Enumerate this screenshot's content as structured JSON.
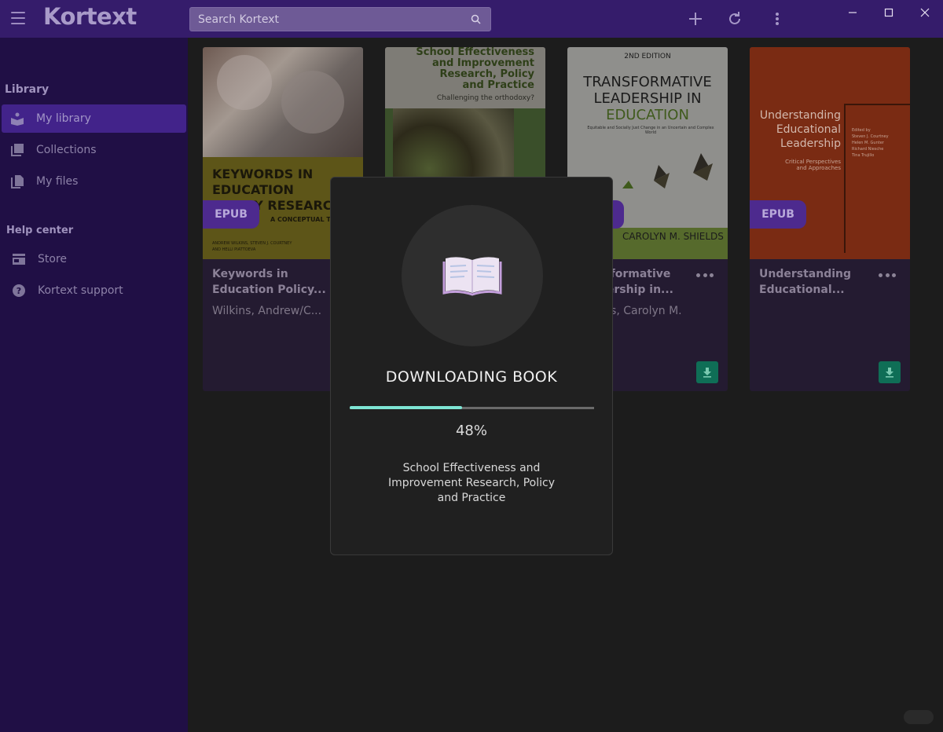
{
  "app": {
    "title": "Kortext",
    "accent": "#351c6b"
  },
  "search": {
    "placeholder": "Search Kortext"
  },
  "sidebar": {
    "library_title": "Library",
    "library_items": [
      {
        "label": "My library",
        "icon": "book-reader-icon",
        "active": true
      },
      {
        "label": "Collections",
        "icon": "collections-icon",
        "active": false
      },
      {
        "label": "My files",
        "icon": "files-icon",
        "active": false
      }
    ],
    "help_title": "Help center",
    "help_items": [
      {
        "label": "Store",
        "icon": "store-icon"
      },
      {
        "label": "Kortext support",
        "icon": "help-circle-icon"
      }
    ]
  },
  "books": [
    {
      "title": "Keywords in Education Policy...",
      "author": "Wilkins, Andrew/C...",
      "badge": "EPUB",
      "cover": {
        "lines": [
          "KEYWORDS IN",
          "EDUCATION",
          "POLICY RESEARCH"
        ],
        "subtitle": "A CONCEPTUAL TOOLBOX",
        "authors": [
          "ANDREW WILKINS, STEVEN J. COURTNEY",
          "AND HELLI PIATTOEVA"
        ]
      }
    },
    {
      "title": "School Effectiveness and Improvement Research, Policy and Practice",
      "author": "",
      "badge": "",
      "cover": {
        "lines": [
          "School Effectiveness",
          "and Improvement",
          "Research, Policy",
          "and Practice"
        ],
        "subtitle": "Challenging the orthodoxy?"
      }
    },
    {
      "title": "Transformative Leadership in...",
      "author": "Shields, Carolyn M.",
      "badge": "EPUB",
      "cover": {
        "edition": "2ND EDITION",
        "lines": [
          "TRANSFORMATIVE",
          "LEADERSHIP IN",
          "EDUCATION"
        ],
        "subtitle": "Equitable and Socially Just Change in an Uncertain and Complex World",
        "author": "CAROLYN M. SHIELDS"
      }
    },
    {
      "title": "Understanding Educational...",
      "author": "",
      "badge": "EPUB",
      "cover": {
        "lines": [
          "Understanding",
          "Educational",
          "Leadership"
        ],
        "subtitle": "Critical Perspectives and Approaches",
        "editors": [
          "Edited by",
          "Steven J. Courtney",
          "Helen M. Gunter",
          "Richard Niesche",
          "Tina Trujillo"
        ]
      }
    }
  ],
  "modal": {
    "heading": "DOWNLOADING BOOK",
    "percent_text": "48%",
    "progress_fraction": 0.46,
    "book_name": "School Effectiveness and Improvement Research, Policy and Practice"
  }
}
